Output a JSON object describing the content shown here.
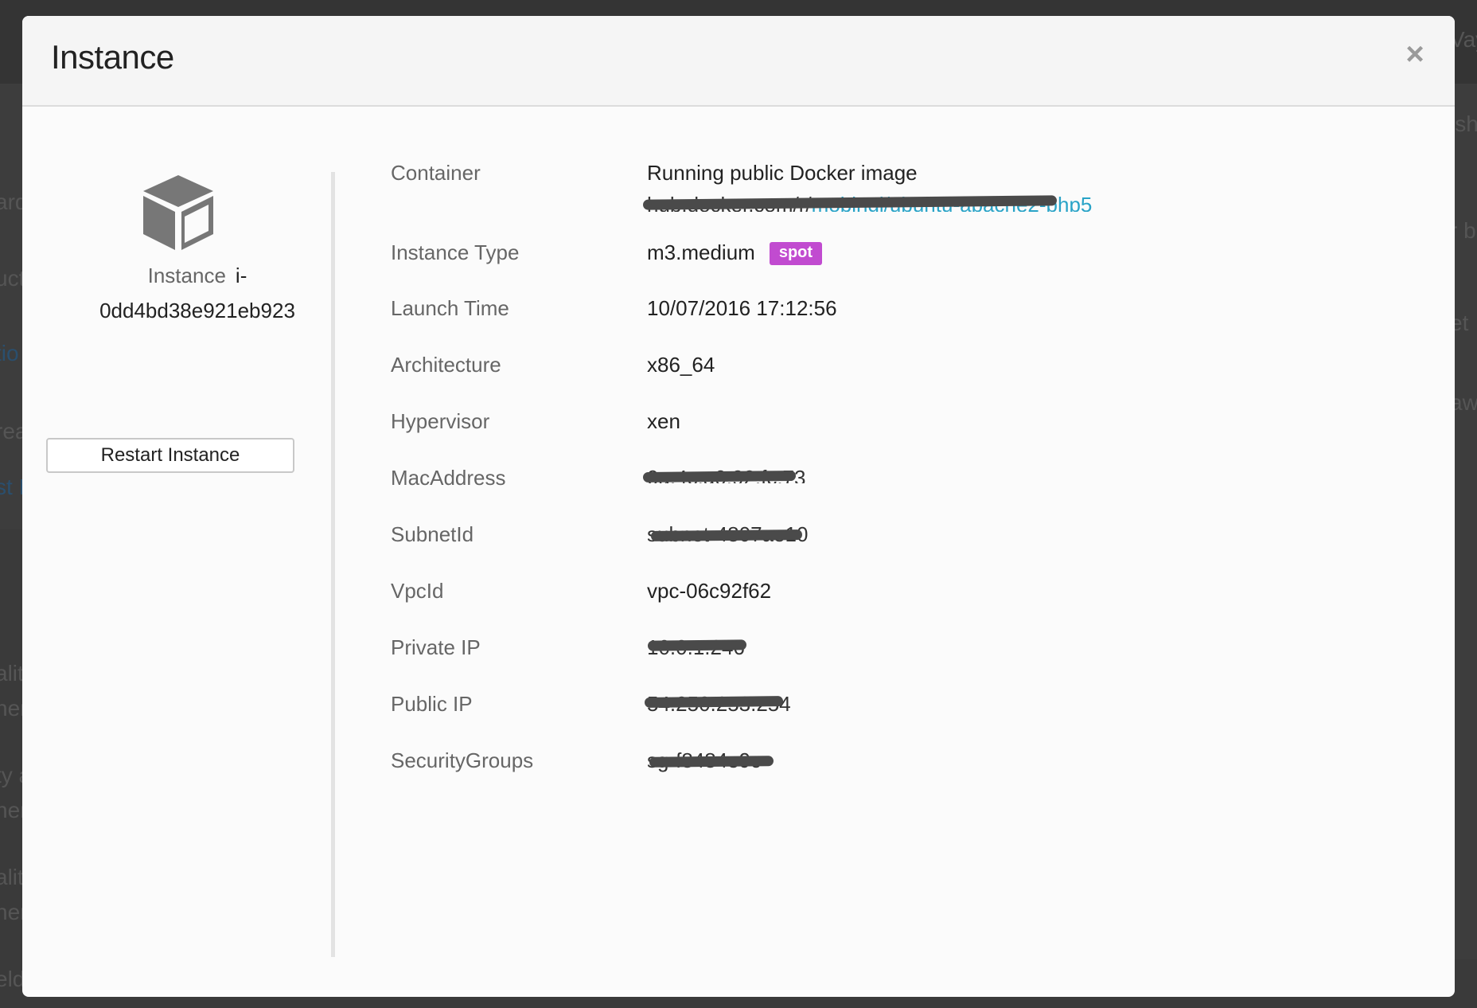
{
  "background": {
    "fragments": [
      "ard",
      "uct",
      "tio",
      "rea",
      "st I",
      "alit",
      "ner",
      "ty a",
      "ner",
      "alit",
      "ner",
      "eld",
      "Vay",
      "ish",
      "r b",
      "et",
      "aw"
    ]
  },
  "modal": {
    "title": "Instance",
    "close_label": "×"
  },
  "instance": {
    "prefix": "Instance",
    "id_part1": "i-",
    "id_part2": "0dd4bd38e921eb923",
    "restart_label": "Restart Instance"
  },
  "details": {
    "container": {
      "label": "Container",
      "value_line1": "Running public Docker image",
      "value_line2_prefix": "hub.docker.com/r/",
      "value_line2_link": "mobingi/ubuntu-apache2-php5"
    },
    "instance_type": {
      "label": "Instance Type",
      "value": "m3.medium",
      "badge": "spot",
      "badge_color": "#c14bd0"
    },
    "launch_time": {
      "label": "Launch Time",
      "value": "10/07/2016 17:12:56"
    },
    "architecture": {
      "label": "Architecture",
      "value": "x86_64"
    },
    "hypervisor": {
      "label": "Hypervisor",
      "value": "xen"
    },
    "mac_address": {
      "label": "MacAddress",
      "value": "0a:4c:a0:92:fc:73"
    },
    "subnet_id": {
      "label": "SubnetId",
      "value": "subnet-4807ae10"
    },
    "vpc_id": {
      "label": "VpcId",
      "value": "vpc-06c92f62"
    },
    "private_ip": {
      "label": "Private IP",
      "value": "10.0.1.246"
    },
    "public_ip": {
      "label": "Public IP",
      "value": "54.250.253.254"
    },
    "security_groups": {
      "label": "SecurityGroups",
      "value": "sg-f8484e9c"
    }
  },
  "colors": {
    "link": "#29a3c7",
    "redaction": "#4a4a4a"
  }
}
